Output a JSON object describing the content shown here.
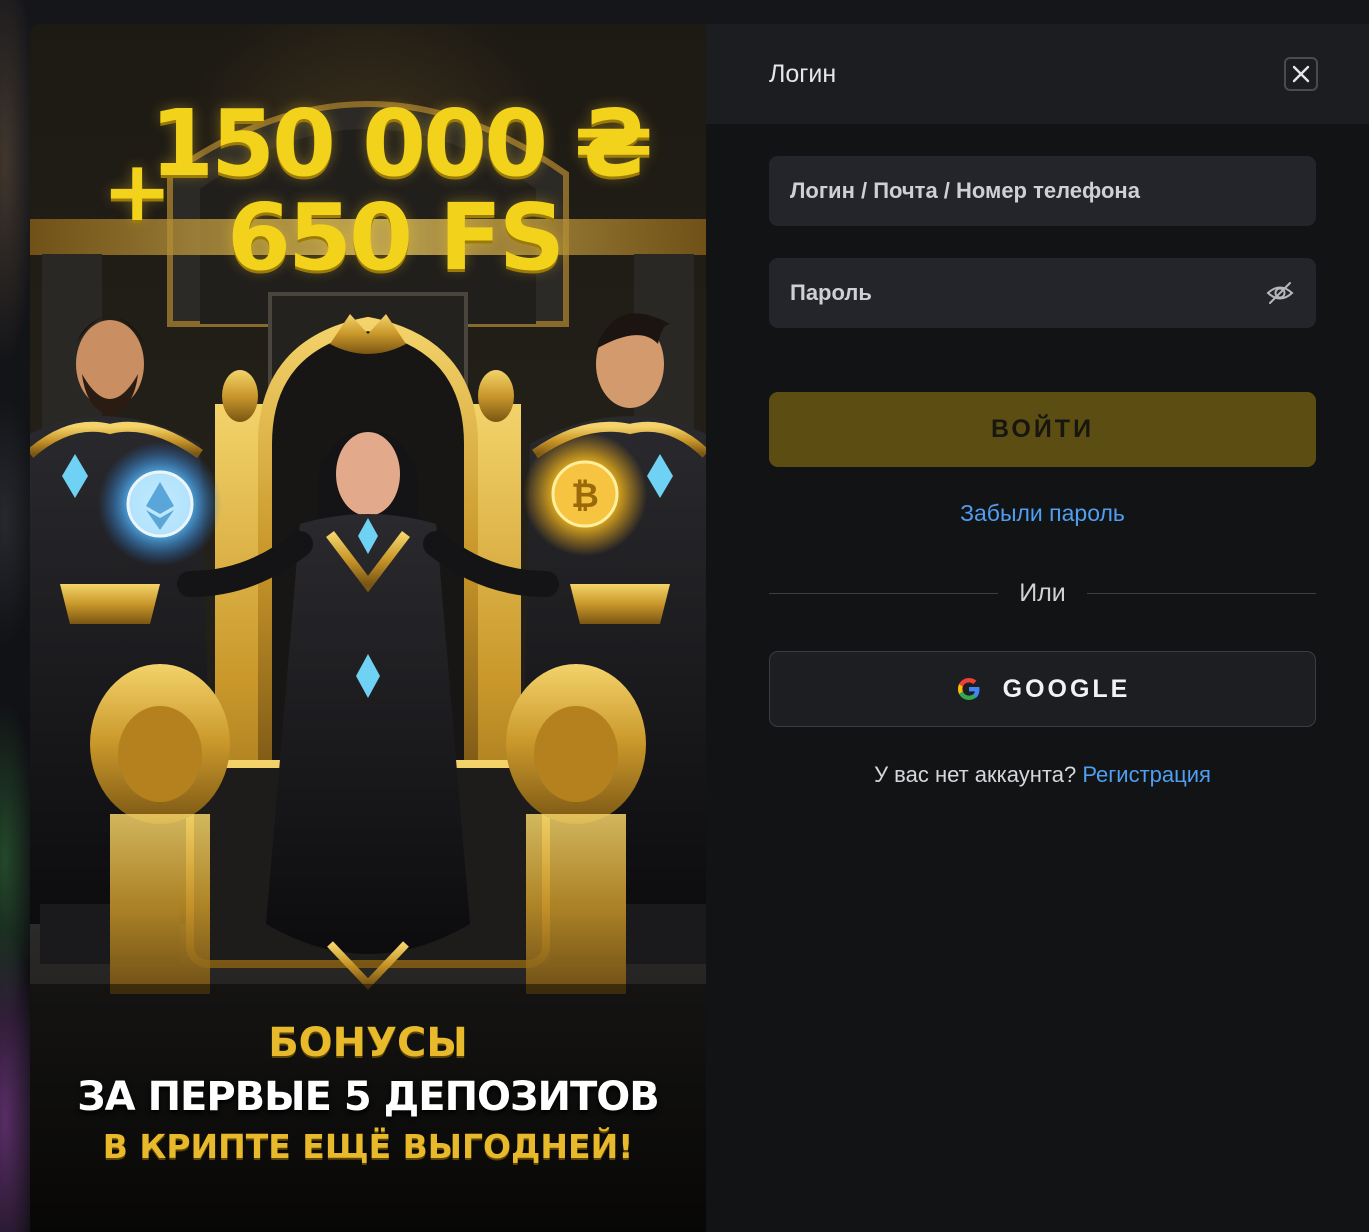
{
  "promo": {
    "amount": "150 000 ₴",
    "plus": "+",
    "free_spins": "650 FS",
    "line1": "БОНУСЫ",
    "line2": "ЗА ПЕРВЫЕ 5 ДЕПОЗИТОВ",
    "line3": "В КРИПТЕ ЕЩЁ ВЫГОДНЕЙ!"
  },
  "login": {
    "title": "Логин",
    "login_placeholder": "Логин / Почта / Номер телефона",
    "password_placeholder": "Пароль",
    "submit_label": "ВОЙТИ",
    "forgot_label": "Забыли пароль",
    "divider_label": "Или",
    "google_label": "GOOGLE",
    "no_account_text": "У вас нет аккаунта?",
    "register_label": "Регистрация"
  },
  "icons": {
    "close": "close-icon",
    "password_visibility": "eye-off-icon",
    "google": "google-icon"
  },
  "colors": {
    "accent_gold": "#f2d21a",
    "submit_button": "#5c4e12",
    "link_blue": "#4f9ef0",
    "panel_bg": "#121315",
    "input_bg": "#24252a"
  }
}
